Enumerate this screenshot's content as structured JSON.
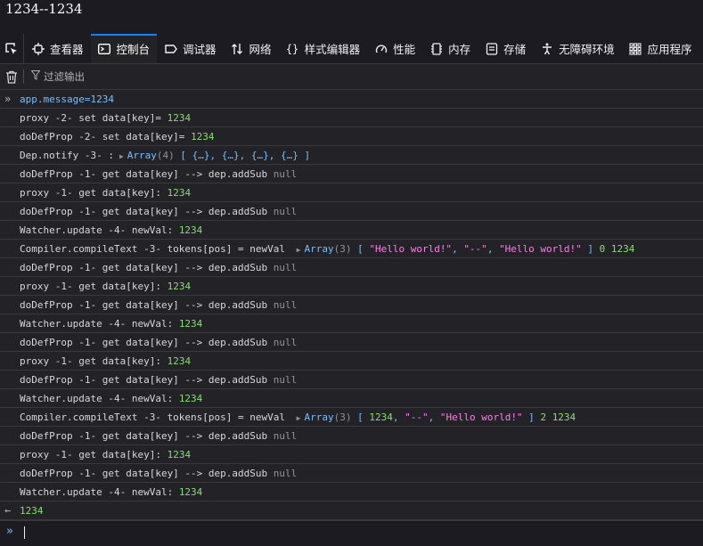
{
  "page": {
    "heading": "1234--1234"
  },
  "tabs": [
    {
      "label": "查看器",
      "icon": "inspector-icon"
    },
    {
      "label": "控制台",
      "icon": "console-icon",
      "active": true
    },
    {
      "label": "调试器",
      "icon": "debugger-icon"
    },
    {
      "label": "网络",
      "icon": "network-icon"
    },
    {
      "label": "样式编辑器",
      "icon": "style-editor-icon"
    },
    {
      "label": "性能",
      "icon": "performance-icon"
    },
    {
      "label": "内存",
      "icon": "memory-icon"
    },
    {
      "label": "存储",
      "icon": "storage-icon"
    },
    {
      "label": "无障碍环境",
      "icon": "accessibility-icon"
    },
    {
      "label": "应用程序",
      "icon": "application-icon"
    }
  ],
  "toolbar": {
    "filter_placeholder": "过滤输出"
  },
  "console": {
    "input_echo": {
      "expr": "app.message=",
      "value": "1234"
    },
    "log_common": {
      "prefix_set_proxy": "proxy -2- set data[key]= ",
      "prefix_set_dodef": "doDefProp -2- set data[key]= ",
      "prefix_dep_notify": "Dep.notify -3- :",
      "dep_array_label": "Array",
      "dep_array_count": "(4)",
      "dep_array_items": "[ {…}, {…}, {…}, {…} ]",
      "prefix_get_dodef": "doDefProp -1- get data[key] --> dep.addSub ",
      "prefix_get_proxy": "proxy -1- get data[key]: ",
      "prefix_watcher": "Watcher.update -4- newVal: ",
      "prefix_compile": "Compiler.compileText -3- tokens[pos] = newVal ",
      "array_label": "Array",
      "array3_count": "(3)",
      "null_text": "null",
      "value": "1234"
    },
    "compile1": {
      "open": "[ ",
      "s1": "\"Hello world!\"",
      "sep1": ", ",
      "s2": "\"--\"",
      "sep2": ", ",
      "s3": "\"Hello world!\"",
      "close": " ]",
      "idx": "0",
      "val": "1234"
    },
    "compile2": {
      "open": "[ ",
      "n1": "1234",
      "sep1": ", ",
      "s2": "\"--\"",
      "sep2": ", ",
      "s3": "\"Hello world!\"",
      "close": " ]",
      "idx": "2",
      "val": "1234"
    },
    "result": "1234"
  }
}
